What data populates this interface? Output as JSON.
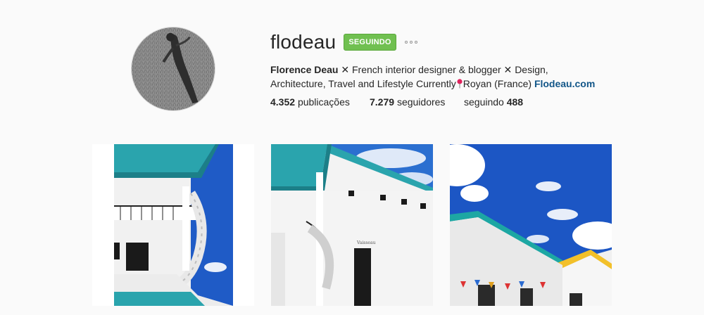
{
  "profile": {
    "username": "flodeau",
    "follow_button": "SEGUINDO",
    "bio": {
      "name": "Florence Deau",
      "separator_1": " ✕ ",
      "text_1": "French interior designer & blogger",
      "separator_2": " ✕ ",
      "text_2": "Design, Architecture, Travel and Lifestyle Currently",
      "location": "Royan (France)",
      "link": "Flodeau.com"
    },
    "stats": {
      "posts_count": "4.352",
      "posts_label": "publicações",
      "followers_count": "7.279",
      "followers_label": "seguidores",
      "following_label": "seguindo",
      "following_count": "488"
    }
  },
  "colors": {
    "follow_green": "#70c050",
    "link_blue": "#125688",
    "sky_blue": "#1c56c4",
    "pool_teal": "#2aa7b0"
  },
  "icons": {
    "more": "more-options-icon",
    "pin": "location-pin-icon"
  }
}
